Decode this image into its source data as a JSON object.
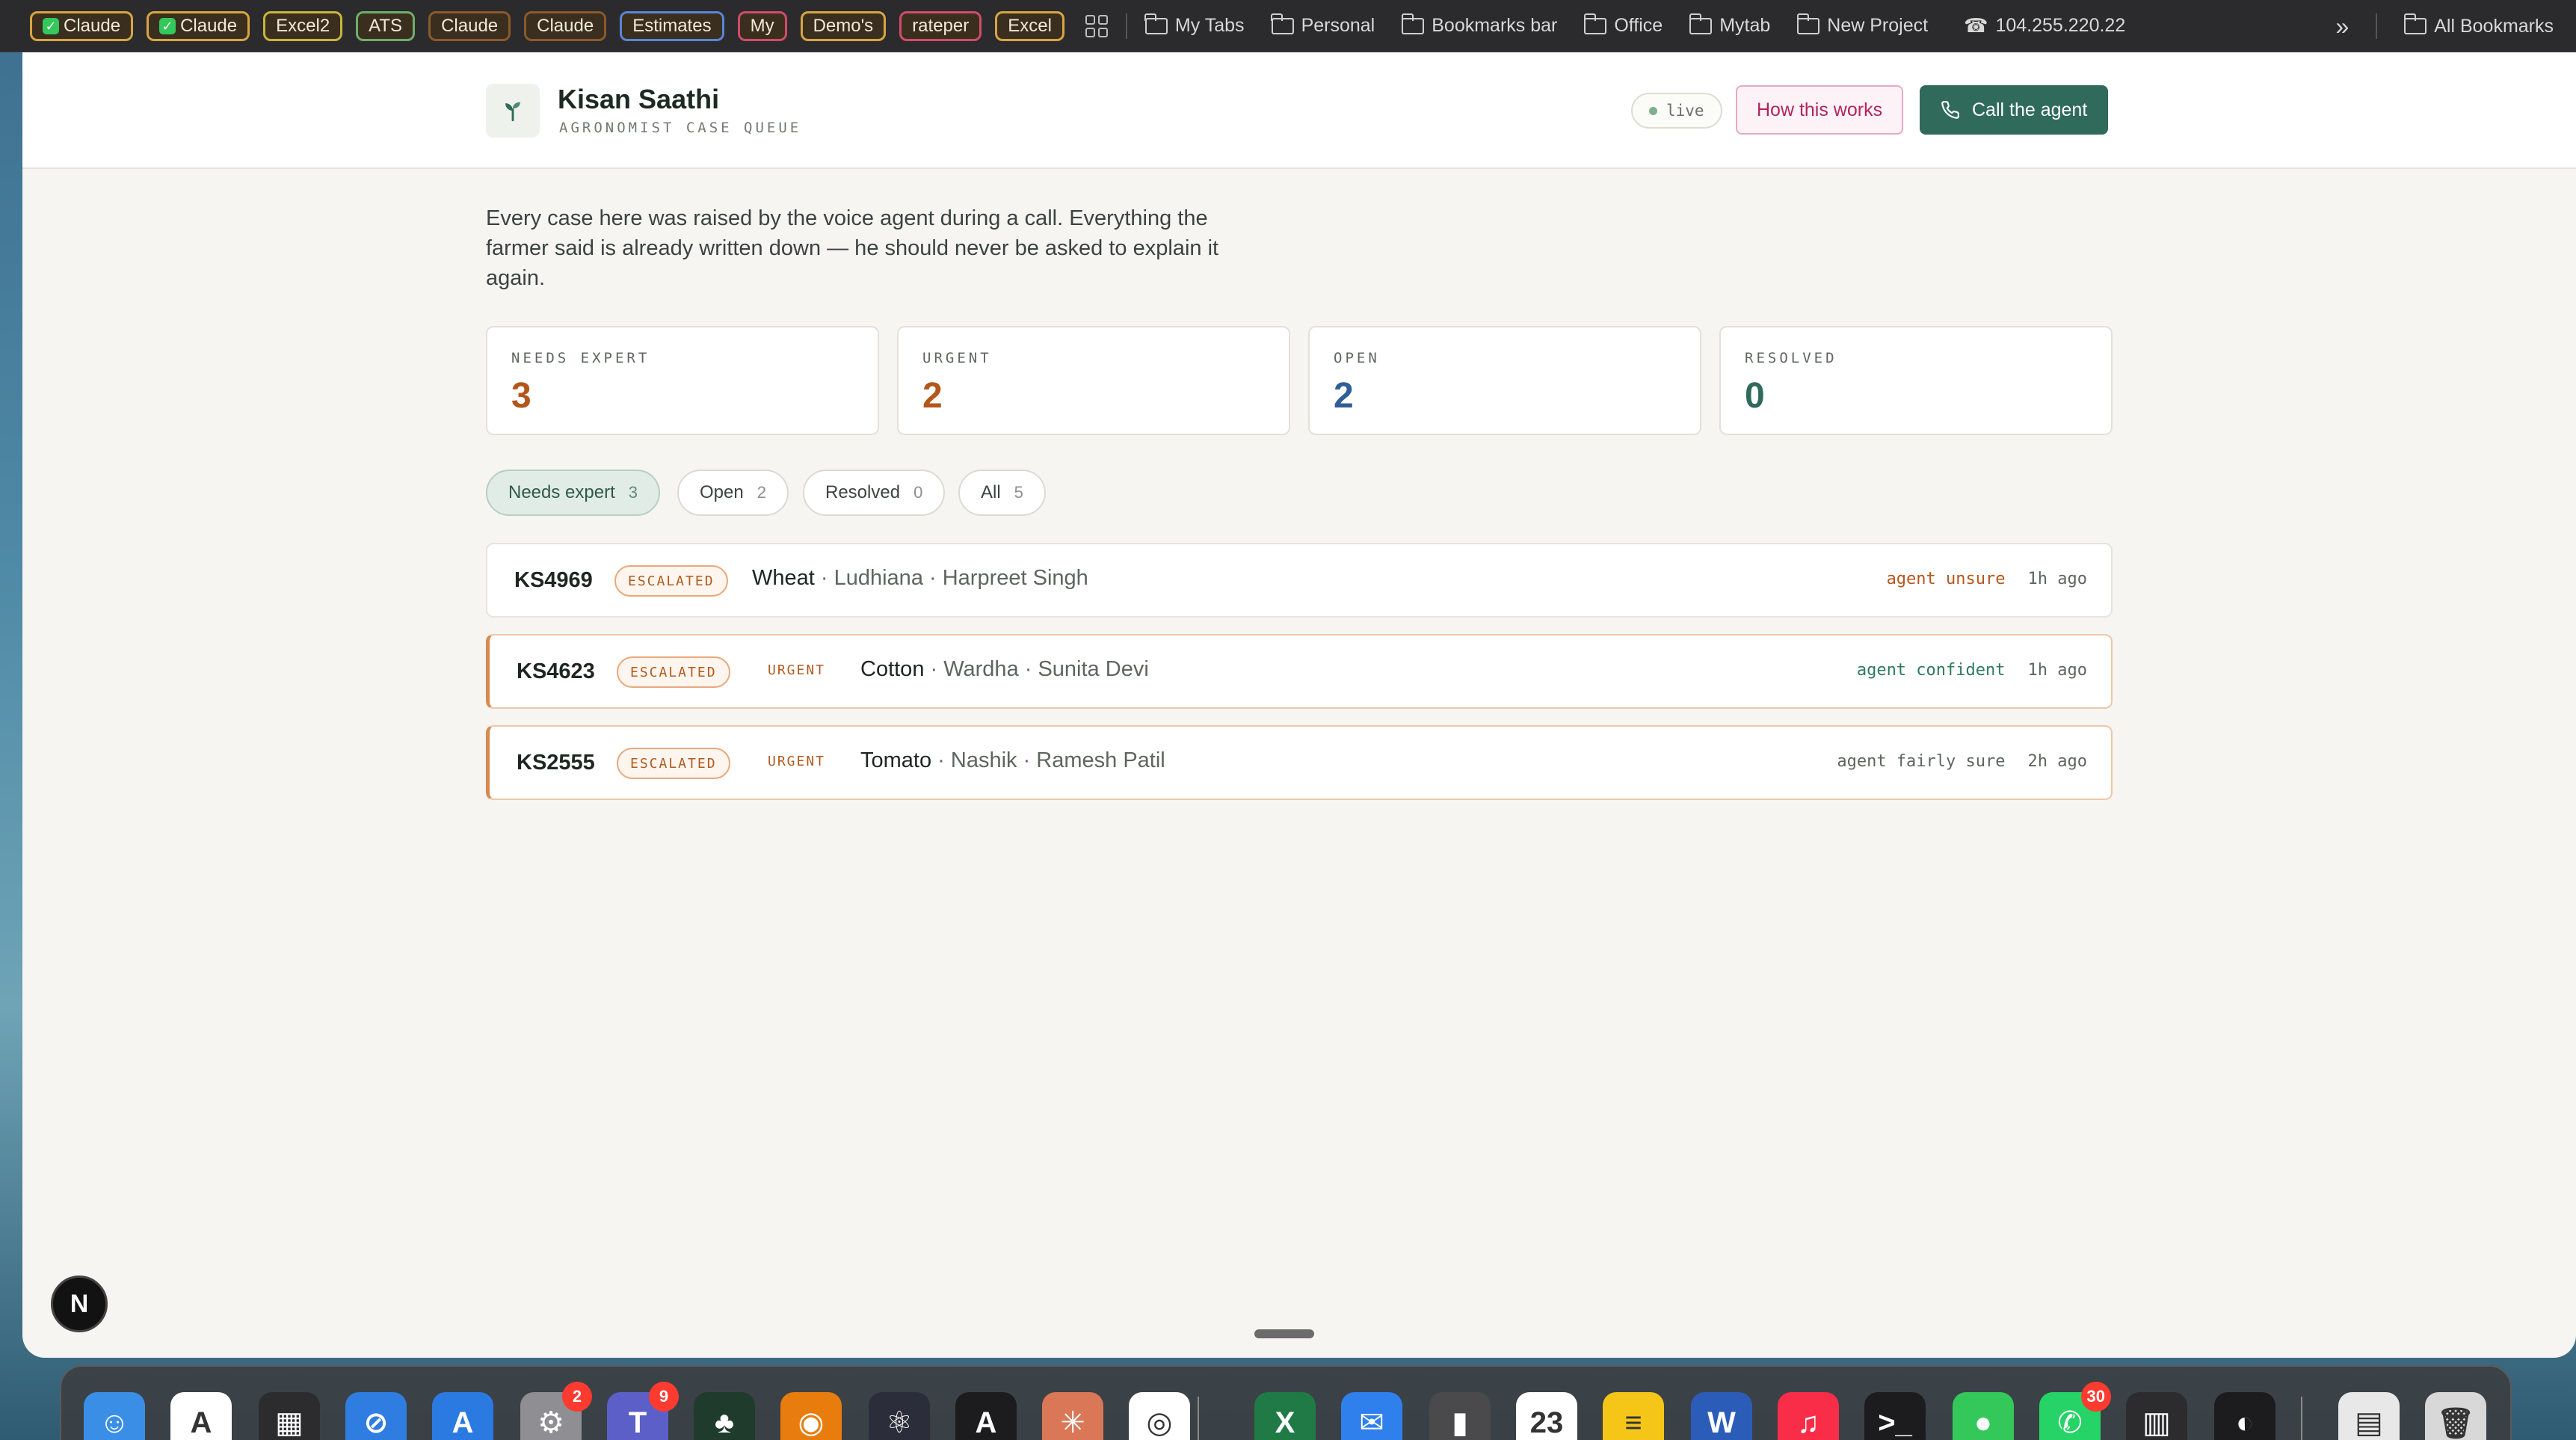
{
  "bookmarks": {
    "pills": [
      {
        "label": "Claude",
        "check": true,
        "color": "#d9a441"
      },
      {
        "label": "Claude",
        "check": true,
        "color": "#d9a441"
      },
      {
        "label": "Excel2",
        "check": false,
        "color": "#c9b53a"
      },
      {
        "label": "ATS",
        "check": false,
        "color": "#6fae6a"
      },
      {
        "label": "Claude",
        "check": false,
        "color": "#8a5a2a"
      },
      {
        "label": "Claude",
        "check": false,
        "color": "#8a5a2a"
      },
      {
        "label": "Estimates",
        "check": false,
        "color": "#5b84d6"
      },
      {
        "label": "My",
        "check": false,
        "color": "#d24b6b"
      },
      {
        "label": "Demo's",
        "check": false,
        "color": "#d9a441"
      },
      {
        "label": "rateper",
        "check": false,
        "color": "#d24b6b"
      },
      {
        "label": "Excel",
        "check": false,
        "color": "#d9a441"
      }
    ],
    "folders": [
      "My Tabs",
      "Personal",
      "Bookmarks bar",
      "Office",
      "Mytab",
      "New Project"
    ],
    "ip_label": "104.255.220.22",
    "overflow_label": "»",
    "all_bookmarks": "All Bookmarks"
  },
  "header": {
    "title": "Kisan Saathi",
    "subtitle": "AGRONOMIST CASE QUEUE",
    "live_label": "live",
    "how_label": "How this works",
    "call_label": "Call the agent"
  },
  "intro": "Every case here was raised by the voice agent during a call. Everything the farmer said is already written down — he should never be asked to explain it again.",
  "stats": [
    {
      "label": "NEEDS EXPERT",
      "value": "3",
      "color": "#b4561c"
    },
    {
      "label": "URGENT",
      "value": "2",
      "color": "#b4561c"
    },
    {
      "label": "OPEN",
      "value": "2",
      "color": "#2f5f96"
    },
    {
      "label": "RESOLVED",
      "value": "0",
      "color": "#2f6a5a"
    }
  ],
  "filters": [
    {
      "label": "Needs expert",
      "count": "3",
      "active": true
    },
    {
      "label": "Open",
      "count": "2",
      "active": false
    },
    {
      "label": "Resolved",
      "count": "0",
      "active": false
    },
    {
      "label": "All",
      "count": "5",
      "active": false
    }
  ],
  "cases": [
    {
      "id": "KS4969",
      "status": "ESCALATED",
      "urgent": false,
      "urgent_label": "",
      "crop": "Wheat",
      "details": " · Ludhiana · Harpreet Singh",
      "confidence": "agent unsure",
      "confidence_color": "#b4561c",
      "ago": "1h ago"
    },
    {
      "id": "KS4623",
      "status": "ESCALATED",
      "urgent": true,
      "urgent_label": "URGENT",
      "crop": "Cotton",
      "details": " · Wardha · Sunita Devi",
      "confidence": "agent confident",
      "confidence_color": "#2f7a5e",
      "ago": "1h ago"
    },
    {
      "id": "KS2555",
      "status": "ESCALATED",
      "urgent": true,
      "urgent_label": "URGENT",
      "crop": "Tomato",
      "details": " · Nashik · Ramesh Patil",
      "confidence": "agent fairly sure",
      "confidence_color": "#5d665f",
      "ago": "2h ago"
    }
  ],
  "dev_badge": "N",
  "dock": {
    "icons": [
      {
        "name": "finder-icon",
        "color": "#3a8ee6",
        "glyph": "☺"
      },
      {
        "name": "arc-icon",
        "color": "#ffffff",
        "glyph": "A"
      },
      {
        "name": "launchpad-icon",
        "color": "#2c2c2e",
        "glyph": "▦"
      },
      {
        "name": "safari-icon",
        "color": "#2f7de1",
        "glyph": "⊘"
      },
      {
        "name": "app-store-icon",
        "color": "#2a7ae2",
        "glyph": "A"
      },
      {
        "name": "system-settings-icon",
        "color": "#8e8e93",
        "glyph": "⚙",
        "badge": "2"
      },
      {
        "name": "teams-icon",
        "color": "#5b5fc7",
        "glyph": "T",
        "badge": "9"
      },
      {
        "name": "mongodb-icon",
        "color": "#1f3b2c",
        "glyph": "♣"
      },
      {
        "name": "blender-icon",
        "color": "#e87d0d",
        "glyph": "◉"
      },
      {
        "name": "electron-icon",
        "color": "#2b2e3a",
        "glyph": "⚛"
      },
      {
        "name": "arc-alt-icon",
        "color": "#1c1c1e",
        "glyph": "A"
      },
      {
        "name": "claude-icon",
        "color": "#d97757",
        "glyph": "✳"
      },
      {
        "name": "chrome-icon",
        "color": "#ffffff",
        "glyph": "◎"
      },
      {
        "name": "excel-icon",
        "color": "#1f7a45",
        "glyph": "X"
      },
      {
        "name": "mail-icon",
        "color": "#2f80ed",
        "glyph": "✉"
      },
      {
        "name": "server-icon",
        "color": "#4a4a4c",
        "glyph": "▮"
      },
      {
        "name": "calendar-icon",
        "color": "#ffffff",
        "glyph": "23"
      },
      {
        "name": "notes-icon",
        "color": "#f5c518",
        "glyph": "≡"
      },
      {
        "name": "word-icon",
        "color": "#2b5cb8",
        "glyph": "W"
      },
      {
        "name": "music-icon",
        "color": "#fa2d48",
        "glyph": "♫"
      },
      {
        "name": "terminal-icon",
        "color": "#1c1c1e",
        "glyph": ">_"
      },
      {
        "name": "messages-icon",
        "color": "#34c759",
        "glyph": "●"
      },
      {
        "name": "whatsapp-icon",
        "color": "#25d366",
        "glyph": "✆",
        "badge": "30"
      },
      {
        "name": "activity-monitor-icon",
        "color": "#2c2c2e",
        "glyph": "▥"
      },
      {
        "name": "github-icon",
        "color": "#1c1c1e",
        "glyph": "◐"
      },
      {
        "name": "downloads-folder-icon",
        "color": "#e8e8e8",
        "glyph": "▤"
      },
      {
        "name": "trash-icon",
        "color": "#d8d8d8",
        "glyph": "🗑"
      }
    ]
  }
}
